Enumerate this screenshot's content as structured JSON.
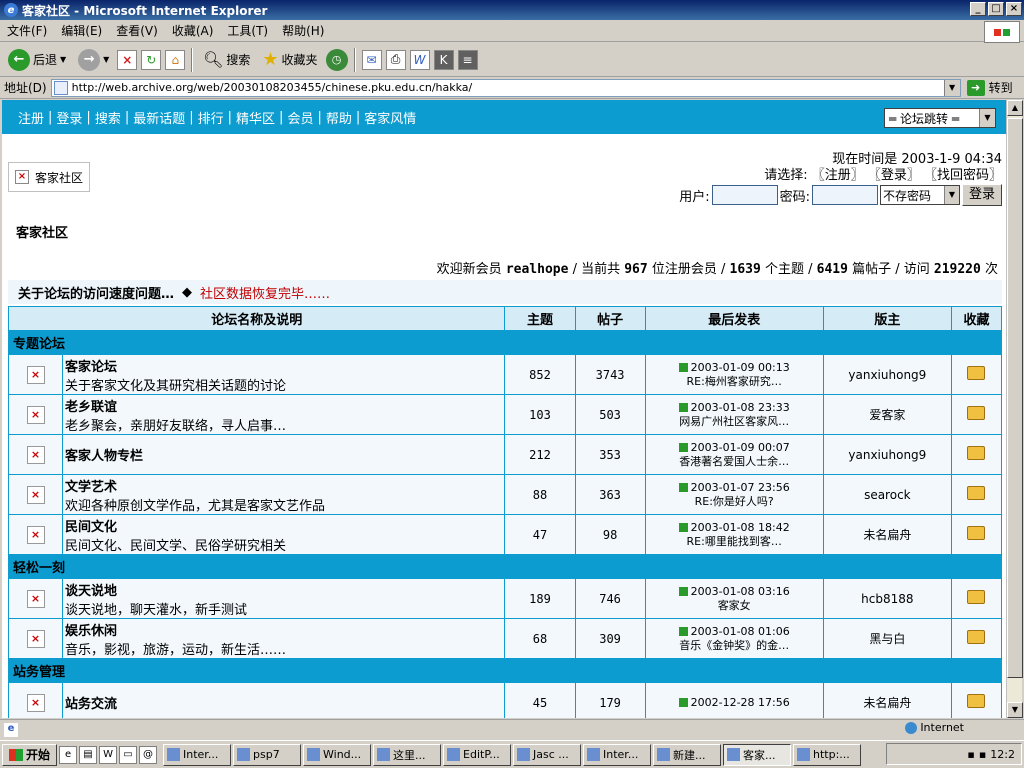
{
  "window": {
    "title": "客家社区 - Microsoft Internet Explorer",
    "min": "_",
    "max": "□",
    "close": "×"
  },
  "menu": [
    "文件(F)",
    "编辑(E)",
    "查看(V)",
    "收藏(A)",
    "工具(T)",
    "帮助(H)"
  ],
  "toolbar": {
    "back": "后退",
    "search": "搜索",
    "favorites": "收藏夹"
  },
  "address": {
    "label": "地址(D)",
    "url": "http://web.archive.org/web/20030108203455/chinese.pku.edu.cn/hakka/",
    "go": "转到"
  },
  "nav": {
    "links": [
      "注册",
      "登录",
      "搜索",
      "最新话题",
      "排行",
      "精华区",
      "会员",
      "帮助",
      "客家风情"
    ],
    "sep": "|",
    "jump": "═ 论坛跳转 ═"
  },
  "logo_alt": "客家社区",
  "header": {
    "time": "现在时间是 2003-1-9 04:34",
    "select": "请选择: 〖注册〗 〖登录〗 〖找回密码〗",
    "user_label": "用户:",
    "pw_label": "密码:",
    "pw_option": "不存密码",
    "login": "登录"
  },
  "forum_title": "客家社区",
  "stats": {
    "welcome": "欢迎新会员",
    "newest": "realhope",
    "t1": "/ 当前共",
    "members": "967",
    "t2": "位注册会员 /",
    "topics": "1639",
    "t3": "个主题 /",
    "posts": "6419",
    "t4": "篇帖子 / 访问",
    "visits": "219220",
    "t5": "次"
  },
  "announce": {
    "a1": "关于论坛的访问速度问题…",
    "diamond": "◆",
    "a2": "社区数据恢复完毕……"
  },
  "table": {
    "headers": [
      "论坛名称及说明",
      "主题",
      "帖子",
      "最后发表",
      "版主",
      "收藏"
    ]
  },
  "categories": [
    {
      "name": "专题论坛",
      "forums": [
        {
          "name": "客家论坛",
          "desc": "关于客家文化及其研究相关话题的讨论",
          "topics": "852",
          "posts": "3743",
          "last_time": "2003-01-09 00:13",
          "last_title": "RE:梅州客家研究…",
          "mod": "yanxiuhong9"
        },
        {
          "name": "老乡联谊",
          "desc": "老乡聚会，亲朋好友联络，寻人启事…",
          "topics": "103",
          "posts": "503",
          "last_time": "2003-01-08 23:33",
          "last_title": "网易广州社区客家风…",
          "mod": "爱客家"
        },
        {
          "name": "客家人物专栏",
          "desc": "",
          "topics": "212",
          "posts": "353",
          "last_time": "2003-01-09 00:07",
          "last_title": "香港著名爱国人士余…",
          "mod": "yanxiuhong9"
        },
        {
          "name": "文学艺术",
          "desc": "欢迎各种原创文学作品，尤其是客家文艺作品",
          "topics": "88",
          "posts": "363",
          "last_time": "2003-01-07 23:56",
          "last_title": "RE:你是好人吗?",
          "mod": "searock"
        },
        {
          "name": "民间文化",
          "desc": "民间文化、民间文学、民俗学研究相关",
          "topics": "47",
          "posts": "98",
          "last_time": "2003-01-08 18:42",
          "last_title": "RE:哪里能找到客…",
          "mod": "未名扁舟"
        }
      ]
    },
    {
      "name": "轻松一刻",
      "forums": [
        {
          "name": "谈天说地",
          "desc": "谈天说地，聊天灌水，新手测试",
          "topics": "189",
          "posts": "746",
          "last_time": "2003-01-08 03:16",
          "last_title": "客家女",
          "mod": "hcb8188"
        },
        {
          "name": "娱乐休闲",
          "desc": "音乐，影视，旅游，运动，新生活……",
          "topics": "68",
          "posts": "309",
          "last_time": "2003-01-08 01:06",
          "last_title": "音乐《金钟奖》的金…",
          "mod": "黑与白"
        }
      ]
    },
    {
      "name": "站务管理",
      "forums": [
        {
          "name": "站务交流",
          "desc": "",
          "topics": "45",
          "posts": "179",
          "last_time": "2002-12-28 17:56",
          "last_title": "",
          "mod": "未名扁舟"
        }
      ]
    }
  ],
  "status": {
    "zone": "Internet"
  },
  "taskbar": {
    "start": "开始",
    "tasks": [
      "Inter...",
      "psp7",
      "Wind...",
      "这里...",
      "EditP...",
      "Jasc ...",
      "Inter...",
      "新建...",
      "客家...",
      "http:..."
    ],
    "active_index": 8,
    "clock": "12:2"
  }
}
